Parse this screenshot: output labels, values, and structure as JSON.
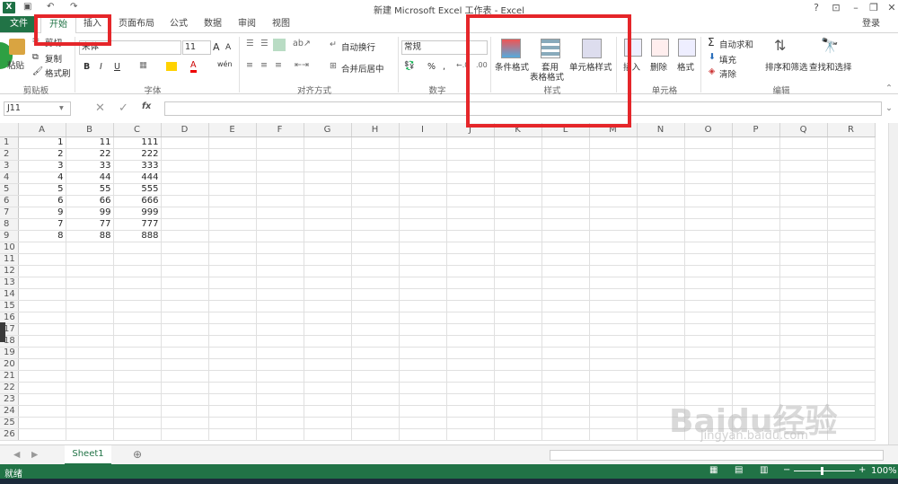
{
  "window": {
    "title": "新建 Microsoft Excel 工作表 - Excel",
    "login": "登录",
    "app_icon": "X"
  },
  "tabs": [
    {
      "label": "文件"
    },
    {
      "label": "开始"
    },
    {
      "label": "插入"
    },
    {
      "label": "页面布局"
    },
    {
      "label": "公式"
    },
    {
      "label": "数据"
    },
    {
      "label": "审阅"
    },
    {
      "label": "视图"
    }
  ],
  "ribbon": {
    "clipboard": {
      "paste": "粘贴",
      "cut": "剪切",
      "copy": "复制",
      "format_painter": "格式刷",
      "label": "剪贴板"
    },
    "font": {
      "name": "宋体",
      "size": "11",
      "bold": "B",
      "italic": "I",
      "underline": "U",
      "grow": "A",
      "shrink": "A",
      "font_color": "A",
      "wen": "wén",
      "label": "字体"
    },
    "alignment": {
      "wrap": "自动换行",
      "merge": "合并后居中",
      "label": "对齐方式"
    },
    "number": {
      "format": "常规",
      "percent": "%",
      "comma": ",",
      "label": "数字"
    },
    "styles": {
      "conditional": "条件格式",
      "table_format_1": "套用",
      "table_format_2": "表格格式",
      "cell_styles": "单元格样式",
      "label": "样式"
    },
    "cells": {
      "insert": "插入",
      "delete": "删除",
      "format": "格式",
      "label": "单元格"
    },
    "editing": {
      "autosum": "自动求和",
      "fill": "填充",
      "clear": "清除",
      "sort": "排序和筛选",
      "find": "查找和选择",
      "label": "编辑"
    }
  },
  "formula_bar": {
    "name_box": "J11",
    "fx": "fx",
    "value": ""
  },
  "columns": [
    "A",
    "B",
    "C",
    "D",
    "E",
    "F",
    "G",
    "H",
    "I",
    "J",
    "K",
    "L",
    "M",
    "N",
    "O",
    "P",
    "Q",
    "R"
  ],
  "rows": [
    {
      "n": "1",
      "a": "1",
      "b": "11",
      "c": "111"
    },
    {
      "n": "2",
      "a": "2",
      "b": "22",
      "c": "222"
    },
    {
      "n": "3",
      "a": "3",
      "b": "33",
      "c": "333"
    },
    {
      "n": "4",
      "a": "4",
      "b": "44",
      "c": "444"
    },
    {
      "n": "5",
      "a": "5",
      "b": "55",
      "c": "555"
    },
    {
      "n": "6",
      "a": "6",
      "b": "66",
      "c": "666"
    },
    {
      "n": "7",
      "a": "9",
      "b": "99",
      "c": "999"
    },
    {
      "n": "8",
      "a": "7",
      "b": "77",
      "c": "777"
    },
    {
      "n": "9",
      "a": "8",
      "b": "88",
      "c": "888"
    },
    {
      "n": "10",
      "a": "",
      "b": "",
      "c": ""
    },
    {
      "n": "11",
      "a": "",
      "b": "",
      "c": ""
    },
    {
      "n": "12",
      "a": "",
      "b": "",
      "c": ""
    },
    {
      "n": "13",
      "a": "",
      "b": "",
      "c": ""
    },
    {
      "n": "14",
      "a": "",
      "b": "",
      "c": ""
    },
    {
      "n": "15",
      "a": "",
      "b": "",
      "c": ""
    },
    {
      "n": "16",
      "a": "",
      "b": "",
      "c": ""
    },
    {
      "n": "17",
      "a": "",
      "b": "",
      "c": ""
    },
    {
      "n": "18",
      "a": "",
      "b": "",
      "c": ""
    },
    {
      "n": "19",
      "a": "",
      "b": "",
      "c": ""
    },
    {
      "n": "20",
      "a": "",
      "b": "",
      "c": ""
    },
    {
      "n": "21",
      "a": "",
      "b": "",
      "c": ""
    },
    {
      "n": "22",
      "a": "",
      "b": "",
      "c": ""
    },
    {
      "n": "23",
      "a": "",
      "b": "",
      "c": ""
    },
    {
      "n": "24",
      "a": "",
      "b": "",
      "c": ""
    },
    {
      "n": "25",
      "a": "",
      "b": "",
      "c": ""
    },
    {
      "n": "26",
      "a": "",
      "b": "",
      "c": ""
    }
  ],
  "sheets": [
    {
      "label": "Sheet1"
    }
  ],
  "status": {
    "ready": "就绪",
    "zoom": "100%"
  },
  "watermark": {
    "text": "Baidu经验",
    "sub": "jingyan.baidu.com"
  },
  "colors": {
    "excel_green": "#217346",
    "highlight_red": "#e5262a"
  }
}
